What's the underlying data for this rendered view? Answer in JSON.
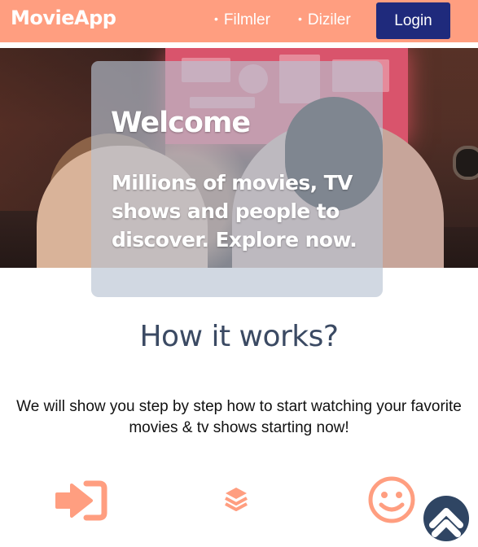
{
  "header": {
    "brand": "MovieApp",
    "nav": [
      {
        "label": "Filmler"
      },
      {
        "label": "Diziler"
      }
    ],
    "login_label": "Login"
  },
  "hero": {
    "title": "Welcome",
    "subtitle": "Millions of movies, TV shows and people to discover. Explore now."
  },
  "how": {
    "title": "How it works?",
    "description": "We will show you step by step how to start watching your favorite movies & tv shows starting now!",
    "icons": [
      "sign-in-icon",
      "layers-icon",
      "smile-icon"
    ]
  },
  "scroll_top": {
    "icon": "chevron-up-icon"
  },
  "colors": {
    "navbar": "#ff9e80",
    "login_button": "#1f2a7c",
    "accent": "#ff9e80",
    "heading": "#3b4a63",
    "scroll_button": "#2f4563"
  }
}
